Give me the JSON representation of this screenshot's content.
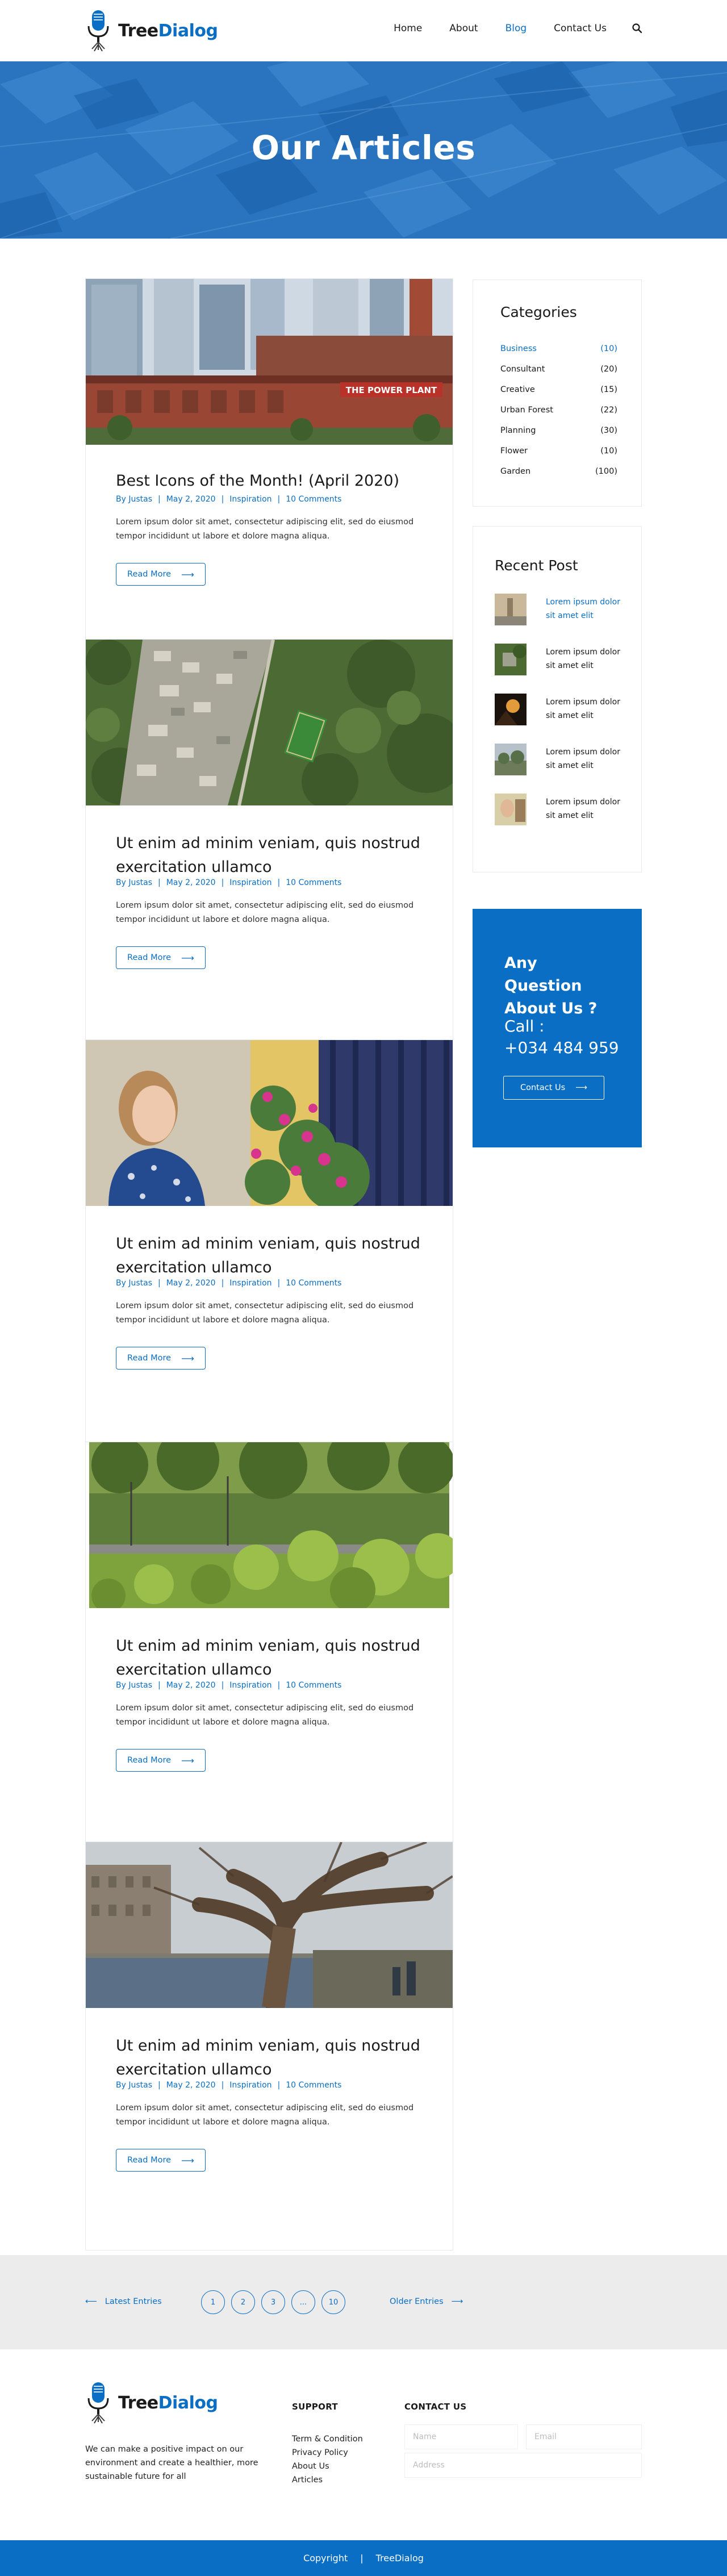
{
  "brand": {
    "name_part1": "Tree",
    "name_part2": "Dialog",
    "primary_color": "#0a6ec4"
  },
  "nav": {
    "items": [
      {
        "label": "Home",
        "active": false
      },
      {
        "label": "About",
        "active": false
      },
      {
        "label": "Blog",
        "active": true
      },
      {
        "label": "Contact Us",
        "active": false
      }
    ],
    "search_icon": "search-icon"
  },
  "hero": {
    "title": "Our Articles"
  },
  "articles": [
    {
      "title": "Best Icons of the Month! (April 2020)",
      "author": "By Justas",
      "date": "May 2, 2020",
      "category": "Inspiration",
      "comments": "10 Comments",
      "excerpt": "Lorem ipsum dolor sit amet, consectetur adipiscing elit, sed do eiusmod tempor incididunt ut labore et dolore magna aliqua.",
      "read_more": "Read More",
      "image_sign": "THE POWER PLANT"
    },
    {
      "title": "Ut enim ad minim veniam, quis nostrud exercitation ullamco",
      "author": "By Justas",
      "date": "May 2, 2020",
      "category": "Inspiration",
      "comments": "10 Comments",
      "excerpt": "Lorem ipsum dolor sit amet, consectetur adipiscing elit, sed do eiusmod tempor incididunt ut labore et dolore magna aliqua.",
      "read_more": "Read More"
    },
    {
      "title": "Ut enim ad minim veniam, quis nostrud exercitation ullamco",
      "author": "By Justas",
      "date": "May 2, 2020",
      "category": "Inspiration",
      "comments": "10 Comments",
      "excerpt": "Lorem ipsum dolor sit amet, consectetur adipiscing elit, sed do eiusmod tempor incididunt ut labore et dolore magna aliqua.",
      "read_more": "Read More"
    },
    {
      "title": "Ut enim ad minim veniam, quis nostrud exercitation ullamco",
      "author": "By Justas",
      "date": "May 2, 2020",
      "category": "Inspiration",
      "comments": "10 Comments",
      "excerpt": "Lorem ipsum dolor sit amet, consectetur adipiscing elit, sed do eiusmod tempor incididunt ut labore et dolore magna aliqua.",
      "read_more": "Read More"
    },
    {
      "title": "Ut enim ad minim veniam, quis nostrud exercitation ullamco",
      "author": "By Justas",
      "date": "May 2, 2020",
      "category": "Inspiration",
      "comments": "10 Comments",
      "excerpt": "Lorem ipsum dolor sit amet, consectetur adipiscing elit, sed do eiusmod tempor incididunt ut labore et dolore magna aliqua.",
      "read_more": "Read More"
    }
  ],
  "sidebar": {
    "categories_title": "Categories",
    "categories": [
      {
        "name": "Business",
        "count": "(10)",
        "active": true
      },
      {
        "name": "Consultant",
        "count": "(20)",
        "active": false
      },
      {
        "name": "Creative",
        "count": "(15)",
        "active": false
      },
      {
        "name": "Urban Forest",
        "count": "(22)",
        "active": false
      },
      {
        "name": "Planning",
        "count": "(30)",
        "active": false
      },
      {
        "name": "Flower",
        "count": "(10)",
        "active": false
      },
      {
        "name": "Garden",
        "count": "(100)",
        "active": false
      }
    ],
    "recent_title": "Recent Post",
    "recent_posts": [
      {
        "title": "Lorem ipsum dolor sit amet elit",
        "active": true
      },
      {
        "title": "Lorem ipsum dolor sit amet elit",
        "active": false
      },
      {
        "title": "Lorem ipsum dolor sit amet elit",
        "active": false
      },
      {
        "title": "Lorem ipsum dolor sit amet elit",
        "active": false
      },
      {
        "title": "Lorem ipsum dolor sit amet elit",
        "active": false
      }
    ],
    "cta": {
      "question": "Any Question About Us ?",
      "call_label": "Call :",
      "phone": "+034 484 959",
      "button": "Contact Us"
    }
  },
  "pagination": {
    "prev": "Latest Entries",
    "next": "Older Entries",
    "pages": [
      "1",
      "2",
      "3",
      "...",
      "10"
    ]
  },
  "footer": {
    "description": "We can make a positive impact on our environment and create a healthier, more sustainable future for all",
    "support_title": "SUPPORT",
    "support_links": [
      "Term & Condition",
      "Privacy Policy",
      "About Us",
      "Articles"
    ],
    "contact_title": "CONTACT US",
    "name_placeholder": "Name",
    "email_placeholder": "Email",
    "address_placeholder": "Address",
    "copyright": "Copyright",
    "copyright_brand": "TreeDialog"
  }
}
